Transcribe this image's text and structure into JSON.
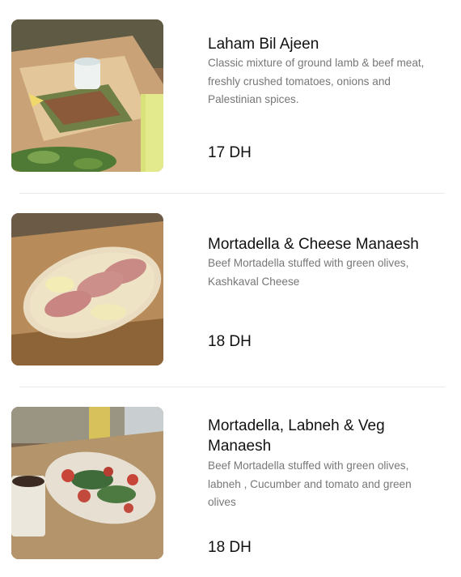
{
  "menu": {
    "items": [
      {
        "name": "Laham Bil Ajeen",
        "description": "Classic mixture of ground lamb & beef meat, freshly crushed tomatoes, onions and Palestinian spices.",
        "price": "17 DH",
        "image_icon": "laham-bil-ajeen-photo"
      },
      {
        "name": "Mortadella & Cheese Manaesh",
        "description": "Beef Mortadella stuffed with green olives, Kashkaval Cheese",
        "price": "18 DH",
        "image_icon": "mortadella-cheese-manaesh-photo"
      },
      {
        "name": "Mortadella, Labneh & Veg Manaesh",
        "description": "Beef Mortadella stuffed with green olives, labneh , Cucumber and tomato and green olives",
        "price": "18 DH",
        "image_icon": "mortadella-labneh-veg-manaesh-photo"
      }
    ]
  }
}
